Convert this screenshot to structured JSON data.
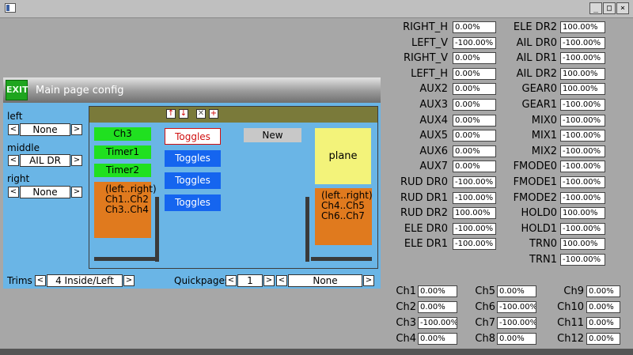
{
  "window": {
    "minimize": "_",
    "maximize": "□",
    "close": "×"
  },
  "sim": {
    "exit_label": "EXIT",
    "title": "Main page config",
    "left_label": "left",
    "left_value": "None",
    "middle_label": "middle",
    "middle_value": "AIL DR",
    "right_label": "right",
    "right_value": "None",
    "trims_label": "Trims",
    "trims_value": "4 Inside/Left",
    "quickpages_label": "Quickpages",
    "quickpages_num": "1",
    "quickpages_value": "None",
    "arrow_left": "<",
    "arrow_right": ">",
    "tools": {
      "up": "↑",
      "down": "↓",
      "delete": "✕",
      "add": "+"
    },
    "green_items": [
      "Ch3",
      "Timer1",
      "Timer2"
    ],
    "toggles": [
      "Toggles",
      "Toggles",
      "Toggles",
      "Toggles"
    ],
    "new_label": "New",
    "plane_label": "plane",
    "left_box": [
      "(left..right)",
      "Ch1..Ch2",
      "Ch3..Ch4"
    ],
    "right_box": [
      "(left..right)",
      "Ch4..Ch5",
      "Ch6..Ch7"
    ]
  },
  "inputs_col1": [
    {
      "label": "RIGHT_H",
      "value": "0.00%"
    },
    {
      "label": "LEFT_V",
      "value": "-100.00%"
    },
    {
      "label": "RIGHT_V",
      "value": "0.00%"
    },
    {
      "label": "LEFT_H",
      "value": "0.00%"
    },
    {
      "label": "AUX2",
      "value": "0.00%"
    },
    {
      "label": "AUX3",
      "value": "0.00%"
    },
    {
      "label": "AUX4",
      "value": "0.00%"
    },
    {
      "label": "AUX5",
      "value": "0.00%"
    },
    {
      "label": "AUX6",
      "value": "0.00%"
    },
    {
      "label": "AUX7",
      "value": "0.00%"
    },
    {
      "label": "RUD DR0",
      "value": "-100.00%"
    },
    {
      "label": "RUD DR1",
      "value": "-100.00%"
    },
    {
      "label": "RUD DR2",
      "value": "100.00%"
    },
    {
      "label": "ELE DR0",
      "value": "-100.00%"
    },
    {
      "label": "ELE DR1",
      "value": "-100.00%"
    }
  ],
  "inputs_col2": [
    {
      "label": "ELE DR2",
      "value": "100.00%"
    },
    {
      "label": "AIL DR0",
      "value": "-100.00%"
    },
    {
      "label": "AIL DR1",
      "value": "-100.00%"
    },
    {
      "label": "AIL DR2",
      "value": "100.00%"
    },
    {
      "label": "GEAR0",
      "value": "100.00%"
    },
    {
      "label": "GEAR1",
      "value": "-100.00%"
    },
    {
      "label": "MIX0",
      "value": "-100.00%"
    },
    {
      "label": "MIX1",
      "value": "-100.00%"
    },
    {
      "label": "MIX2",
      "value": "-100.00%"
    },
    {
      "label": "FMODE0",
      "value": "-100.00%"
    },
    {
      "label": "FMODE1",
      "value": "-100.00%"
    },
    {
      "label": "FMODE2",
      "value": "-100.00%"
    },
    {
      "label": "HOLD0",
      "value": "100.00%"
    },
    {
      "label": "HOLD1",
      "value": "-100.00%"
    },
    {
      "label": "TRN0",
      "value": "100.00%"
    },
    {
      "label": "TRN1",
      "value": "-100.00%"
    }
  ],
  "channels": [
    {
      "label": "Ch1",
      "value": "0.00%"
    },
    {
      "label": "Ch2",
      "value": "0.00%"
    },
    {
      "label": "Ch3",
      "value": "-100.00%"
    },
    {
      "label": "Ch4",
      "value": "0.00%"
    },
    {
      "label": "Ch5",
      "value": "0.00%"
    },
    {
      "label": "Ch6",
      "value": "-100.00%"
    },
    {
      "label": "Ch7",
      "value": "-100.00%"
    },
    {
      "label": "Ch8",
      "value": "0.00%"
    },
    {
      "label": "Ch9",
      "value": "0.00%"
    },
    {
      "label": "Ch10",
      "value": "0.00%"
    },
    {
      "label": "Ch11",
      "value": "0.00%"
    },
    {
      "label": "Ch12",
      "value": "0.00%"
    }
  ]
}
